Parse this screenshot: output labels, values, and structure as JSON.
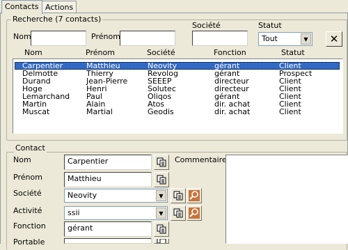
{
  "tabs": [
    {
      "label": "Contacts",
      "active": true
    },
    {
      "label": "Actions",
      "active": false
    }
  ],
  "search": {
    "legend": "Recherche (7 contacts)",
    "nom_label": "Nom",
    "nom_value": "",
    "prenom_label": "Prénom",
    "prenom_value": "",
    "societe_label": "Société",
    "societe_value": "",
    "statut_label": "Statut",
    "statut_value": "Tout",
    "clear_symbol": "✕"
  },
  "list": {
    "columns": [
      "Nom",
      "Prénom",
      "Société",
      "Fonction",
      "Statut"
    ],
    "rows": [
      {
        "nom": "Carpentier",
        "prenom": "Matthieu",
        "societe": "Neovity",
        "fonction": "gérant",
        "statut": "Client",
        "selected": true
      },
      {
        "nom": "Delmotte",
        "prenom": "Thierry",
        "societe": "Revolog",
        "fonction": "gérant",
        "statut": "Prospect"
      },
      {
        "nom": "Durand",
        "prenom": "Jean-Pierre",
        "societe": "SEEEP",
        "fonction": "directeur",
        "statut": "Client"
      },
      {
        "nom": "Hoge",
        "prenom": "Henri",
        "societe": "Solutec",
        "fonction": "directeur",
        "statut": "Client"
      },
      {
        "nom": "Lemarchand",
        "prenom": "Paul",
        "societe": "Oliqos",
        "fonction": "gérant",
        "statut": "Client"
      },
      {
        "nom": "Martin",
        "prenom": "Alain",
        "societe": "Atos",
        "fonction": "dir. achat",
        "statut": "Client"
      },
      {
        "nom": "Muscat",
        "prenom": "Martial",
        "societe": "Geodis",
        "fonction": "dir. achat",
        "statut": "Client"
      }
    ]
  },
  "contact": {
    "legend": "Contact",
    "nom_label": "Nom",
    "nom_value": "Carpentier",
    "prenom_label": "Prénom",
    "prenom_value": "Matthieu",
    "societe_label": "Société",
    "societe_value": "Neovity",
    "activite_label": "Activité",
    "activite_value": "ssii",
    "fonction_label": "Fonction",
    "fonction_value": "gérant",
    "portable_label": "Portable",
    "portable_value": "",
    "commentaires_label": "Commentaires",
    "commentaires_value": ""
  },
  "icons": {
    "copy": "copy-icon",
    "search": "search-icon",
    "dropdown": "chevron-down-icon",
    "close": "close-icon"
  },
  "colors": {
    "selection": "#3169c6",
    "window_bg": "#ece9d8",
    "search_icon_bg": "#c8743a"
  }
}
